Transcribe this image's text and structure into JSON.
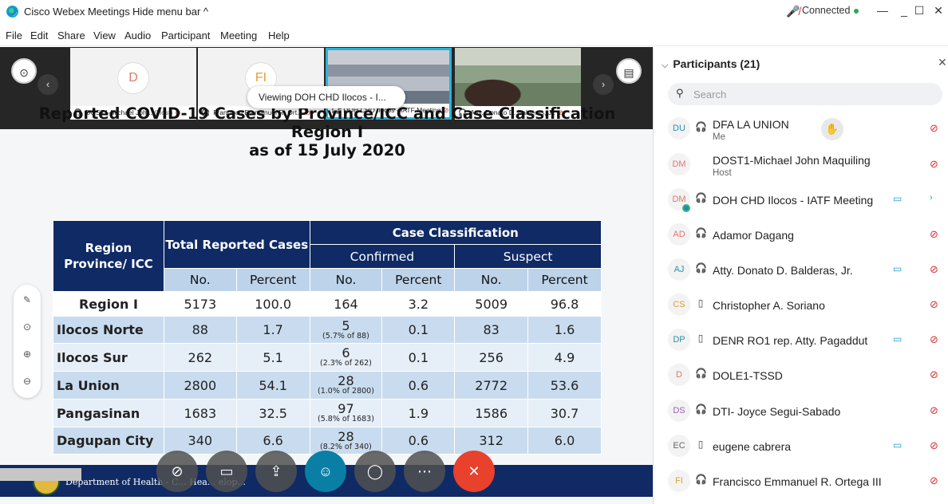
{
  "window": {
    "app_title": "Cisco Webex Meetings",
    "hide_menu": "Hide menu bar ^",
    "status": "Connected",
    "status_color": "#2fa84f",
    "controls": [
      "—",
      "☐",
      "✕"
    ]
  },
  "menu": [
    "File",
    "Edit",
    "Share",
    "View",
    "Audio",
    "Participant",
    "Meeting",
    "Help"
  ],
  "filmstrip": {
    "tiles": [
      {
        "initials": "D",
        "name": "DOST1-Michael Joh...",
        "tag": "(Host)",
        "active": false
      },
      {
        "initials": "FI",
        "name": "Francisco Emmanuel R. Ort...",
        "tag": "",
        "active": false
      },
      {
        "initials": "",
        "name": "DOH CHD Ilocos - IATF Meeting",
        "tag": "",
        "active": true
      },
      {
        "initials": "",
        "name": "Atty. Donato D. Balderas, Jr.",
        "tag": "",
        "active": false
      }
    ]
  },
  "viewing_label": "Viewing DOH CHD Ilocos - I...",
  "slide": {
    "title_line1": "Reported COVID-19 Cases by Province/ICC and Case Classification",
    "title_line2": "Region I",
    "title_line3": "as of 15 July 2020",
    "headers": {
      "region": "Region Province/ ICC",
      "total": "Total Reported Cases",
      "case_class": "Case Classification",
      "confirmed": "Confirmed",
      "suspect": "Suspect",
      "no": "No.",
      "percent": "Percent"
    },
    "rows": [
      {
        "name": "Region I",
        "total_no": "5173",
        "total_pct": "100.0",
        "conf_no": "164",
        "conf_note": "",
        "conf_pct": "3.2",
        "susp_no": "5009",
        "susp_pct": "96.8"
      },
      {
        "name": "Ilocos Norte",
        "total_no": "88",
        "total_pct": "1.7",
        "conf_no": "5",
        "conf_note": "(5.7% of 88)",
        "conf_pct": "0.1",
        "susp_no": "83",
        "susp_pct": "1.6"
      },
      {
        "name": "Ilocos Sur",
        "total_no": "262",
        "total_pct": "5.1",
        "conf_no": "6",
        "conf_note": "(2.3% of 262)",
        "conf_pct": "0.1",
        "susp_no": "256",
        "susp_pct": "4.9"
      },
      {
        "name": "La Union",
        "total_no": "2800",
        "total_pct": "54.1",
        "conf_no": "28",
        "conf_note": "(1.0% of 2800)",
        "conf_pct": "0.6",
        "susp_no": "2772",
        "susp_pct": "53.6"
      },
      {
        "name": "Pangasinan",
        "total_no": "1683",
        "total_pct": "32.5",
        "conf_no": "97",
        "conf_note": "(5.8% of 1683)",
        "conf_pct": "1.9",
        "susp_no": "1586",
        "susp_pct": "30.7"
      },
      {
        "name": "Dagupan City",
        "total_no": "340",
        "total_pct": "6.6",
        "conf_no": "28",
        "conf_note": "(8.2% of 340)",
        "conf_pct": "0.6",
        "susp_no": "312",
        "susp_pct": "6.0"
      }
    ],
    "footer_text": "Department of Health - C... Hea... elop..."
  },
  "participants": {
    "title": "Participants (21)",
    "search_placeholder": "Search",
    "list": [
      {
        "initials": "DU",
        "color": "#2a8fb0",
        "name": "DFA LA UNION",
        "role": "Me",
        "device": "headset",
        "video": false,
        "hand": true
      },
      {
        "initials": "DM",
        "color": "#e0776b",
        "name": "DOST1-Michael John Maquiling",
        "role": "Host",
        "device": "none",
        "video": false
      },
      {
        "initials": "DM",
        "color": "#e0776b",
        "name": "DOH CHD Ilocos - IATF Meeting",
        "role": "",
        "device": "headset",
        "video": true,
        "live": true
      },
      {
        "initials": "AD",
        "color": "#e0776b",
        "name": "Adamor Dagang",
        "role": "",
        "device": "headset",
        "video": false
      },
      {
        "initials": "AJ",
        "color": "#2a8fb0",
        "name": "Atty. Donato D. Balderas, Jr.",
        "role": "",
        "device": "headset",
        "video": true
      },
      {
        "initials": "CS",
        "color": "#e0a030",
        "name": "Christopher A. Soriano",
        "role": "",
        "device": "phone",
        "video": false
      },
      {
        "initials": "DP",
        "color": "#2a8fb0",
        "name": "DENR RO1 rep. Atty. Pagaddut",
        "role": "",
        "device": "phone",
        "video": true
      },
      {
        "initials": "D",
        "color": "#e0776b",
        "name": "DOLE1-TSSD",
        "role": "",
        "device": "headset",
        "video": false
      },
      {
        "initials": "DS",
        "color": "#9a62b3",
        "name": "DTI- Joyce Segui-Sabado",
        "role": "",
        "device": "headset",
        "video": false
      },
      {
        "initials": "EC",
        "color": "#666666",
        "name": "eugene cabrera",
        "role": "",
        "device": "phone",
        "video": true
      },
      {
        "initials": "FI",
        "color": "#e0a030",
        "name": "Francisco Emmanuel R. Ortega III",
        "role": "",
        "device": "headset",
        "video": false
      }
    ]
  }
}
